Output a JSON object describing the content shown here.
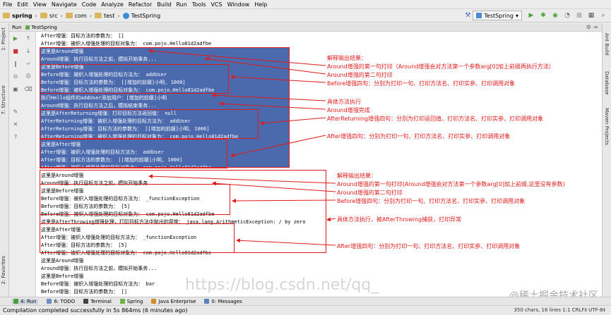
{
  "menu": [
    "File",
    "Edit",
    "View",
    "Navigate",
    "Code",
    "Analyze",
    "Refactor",
    "Build",
    "Run",
    "Tools",
    "VCS",
    "Window",
    "Help"
  ],
  "breadcrumbs": [
    {
      "label": "spring",
      "icon": "folder-icon"
    },
    {
      "label": "src",
      "icon": "folder-icon"
    },
    {
      "label": "com",
      "icon": "folder-icon"
    },
    {
      "label": "test",
      "icon": "folder-icon"
    },
    {
      "label": "TestSpring",
      "icon": "class-icon"
    }
  ],
  "run_config": "TestSpring",
  "run_tab": {
    "label": "Run",
    "config": "TestSpring"
  },
  "left_tabs": [
    "1: Project",
    "7: Structure",
    "2: Favorites"
  ],
  "right_tabs": [
    "Ant Build",
    "Database",
    "Maven Projects"
  ],
  "console": {
    "lines": [
      "After增强：目标方法的参数为： []",
      "After增强：被织入增强处理的目标对象为： com.pojo.Hello81d2adfbe",
      "这里是Around增强",
      "Around增强：执行目标方法之前，模拟开始事务...",
      "这里是Before增强",
      "Before增强：被织入增强处理的目标方法为： addUser",
      "Before增强：目标方法的参数为： [[增加的前缀]小明, 1000]",
      "Before增强：被织入增强处理的目标对象为： com.pojo.Hello81d2adfbe",
      "执行Hello组件的addUser添加用户：[增加的前缀]小明",
      "Around增强：执行目标方法之后，模拟结束事务...",
      "这里是AfterReturning增强：打印目标方法返回值： null",
      "AfterReturning增强：被织入增强处理的目标方法为： addUser",
      "AfterReturning增强：目标方法的参数为： [[增加的前缀]小明, 1000]",
      "AfterReturning增强：被织入增强处理的目标对象为： com.pojo.Hello81d2adfbe",
      "这里是After增强",
      "After增强：被织入增强处理的目标方法为： addUser",
      "After增强：目标方法的参数为： [[增加的前缀]小明, 1000]",
      "After增强：被织入增强处理的目标对象为： com.pojo.Hello81d2adfbe",
      "这里是Around增强",
      "Around增强：执行目标方法之前，模拟开始事务...",
      "这里是Before增强",
      "Before增强：被织入增强处理的目标方法为： _functionException",
      "Before增强：目标方法的参数为： [5]",
      "Before增强：被织入增强处理的目标对象为： com.pojo.Hello81d2adfbe",
      "这里是AfterThrowing增强处理，打印目标方法中抛出的异常： java.lang.ArithmeticException: / by zero",
      "这里是After增强",
      "After增强：被织入增强处理的目标方法为： _functionException",
      "After增强：目标方法的参数为： [5]",
      "After增强：被织入增强处理的目标对象为： com.pojo.Hello81d2adfbe",
      "这里是Around增强",
      "Around增强：执行目标方法之前，模拟开始事务...",
      "这里是Before增强",
      "Before增强：被织入增强处理的目标方法为： bar",
      "Before增强：目标方法的参数为： []",
      "Before增强：被织入增强处理的目标对象为： com.pojo.Hello81d2adfbe"
    ]
  },
  "annotations_top": [
    "解释输出结果：",
    "Around增强的第一句打印（Around增强会对方法第一个参数arg[0]加上前缀再执行方法）",
    "Around增强的第二句打印",
    "Before增强四句：分别为打印一句、打印方法名、打印实参、打印调用对象",
    "具体方法执行",
    "Around增强完成",
    "AfterReturning增强四句：分别为打印返回值、打印方法名、打印实参、打印调用对象",
    "After增强四句：分别为打印一句、打印方法名、打印实参、打印调用对象"
  ],
  "annotations_bottom": [
    "解释输出结果：",
    "Around增强的第一句打印(Around增强会对方法第一个参数arg[0]加上前缀,这里没有参数)",
    "Around增强的第二句打印",
    "Before增强四句：分别为打印一句、打印方法名、打印实参、打印调用对象",
    "具体方法执行，被AfterThrowing捕获，打印异常",
    "After增强四句：分别为打印一句、打印方法名、打印实参、打印调用对象"
  ],
  "bottom_tabs": [
    "4: Run",
    "6: TODO",
    "Terminal",
    "Spring",
    "Java Enterprise",
    "0: Messages"
  ],
  "status": {
    "message": "Compilation completed successfully in 5s 864ms (6 minutes ago)",
    "right": "350 chars, 16 lines   1:1   CRLF‡  UTF-8‡"
  },
  "watermark": "https://blog.csdn.net/qq_",
  "watermark_right": "@稀土掘金技术社区",
  "colors": {
    "selection": "#4a6aad",
    "annotation": "#e01b1b"
  }
}
